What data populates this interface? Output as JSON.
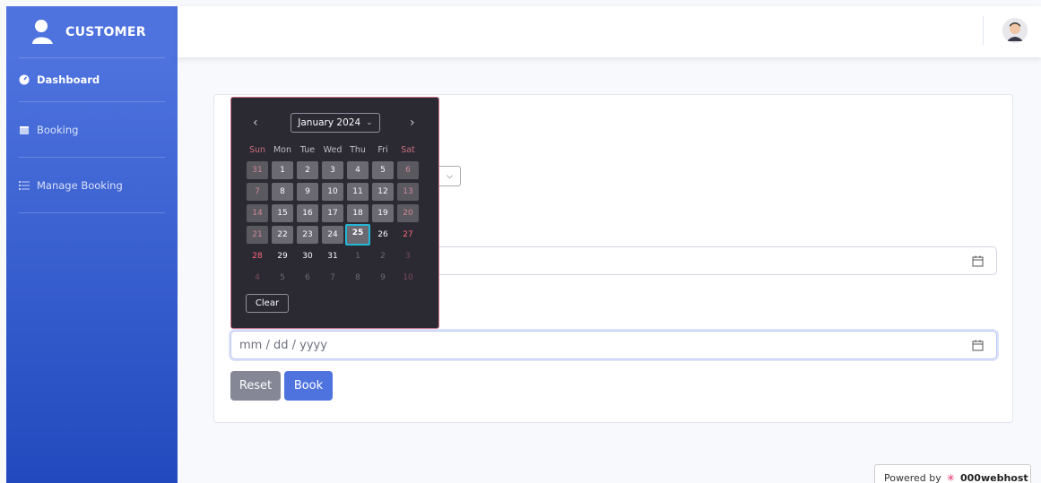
{
  "sidebar": {
    "brand": "CUSTOMER",
    "items": [
      {
        "label": "Dashboard",
        "icon": "dashboard-icon"
      },
      {
        "label": "Booking",
        "icon": "calendar-icon"
      },
      {
        "label": "Manage Booking",
        "icon": "list-icon"
      }
    ]
  },
  "form": {
    "date_placeholder": "mm / dd / yyyy",
    "reset_label": "Reset",
    "book_label": "Book"
  },
  "datepicker": {
    "month_label": "January 2024",
    "weekdays": [
      "Sun",
      "Mon",
      "Tue",
      "Wed",
      "Thu",
      "Fri",
      "Sat"
    ],
    "weeks": [
      [
        "31",
        "1",
        "2",
        "3",
        "4",
        "5",
        "6"
      ],
      [
        "7",
        "8",
        "9",
        "10",
        "11",
        "12",
        "13"
      ],
      [
        "14",
        "15",
        "16",
        "17",
        "18",
        "19",
        "20"
      ],
      [
        "21",
        "22",
        "23",
        "24",
        "25",
        "26",
        "27"
      ],
      [
        "28",
        "29",
        "30",
        "31",
        "1",
        "2",
        "3"
      ],
      [
        "4",
        "5",
        "6",
        "7",
        "8",
        "9",
        "10"
      ]
    ],
    "today": "25",
    "clear_label": "Clear"
  },
  "footer": {
    "powered_by": "Powered by",
    "host": "000webhost"
  },
  "colors": {
    "primary": "#4e73df",
    "secondary": "#858796",
    "picker_bg": "#2b2a33",
    "today_ring": "#22b7d7"
  }
}
